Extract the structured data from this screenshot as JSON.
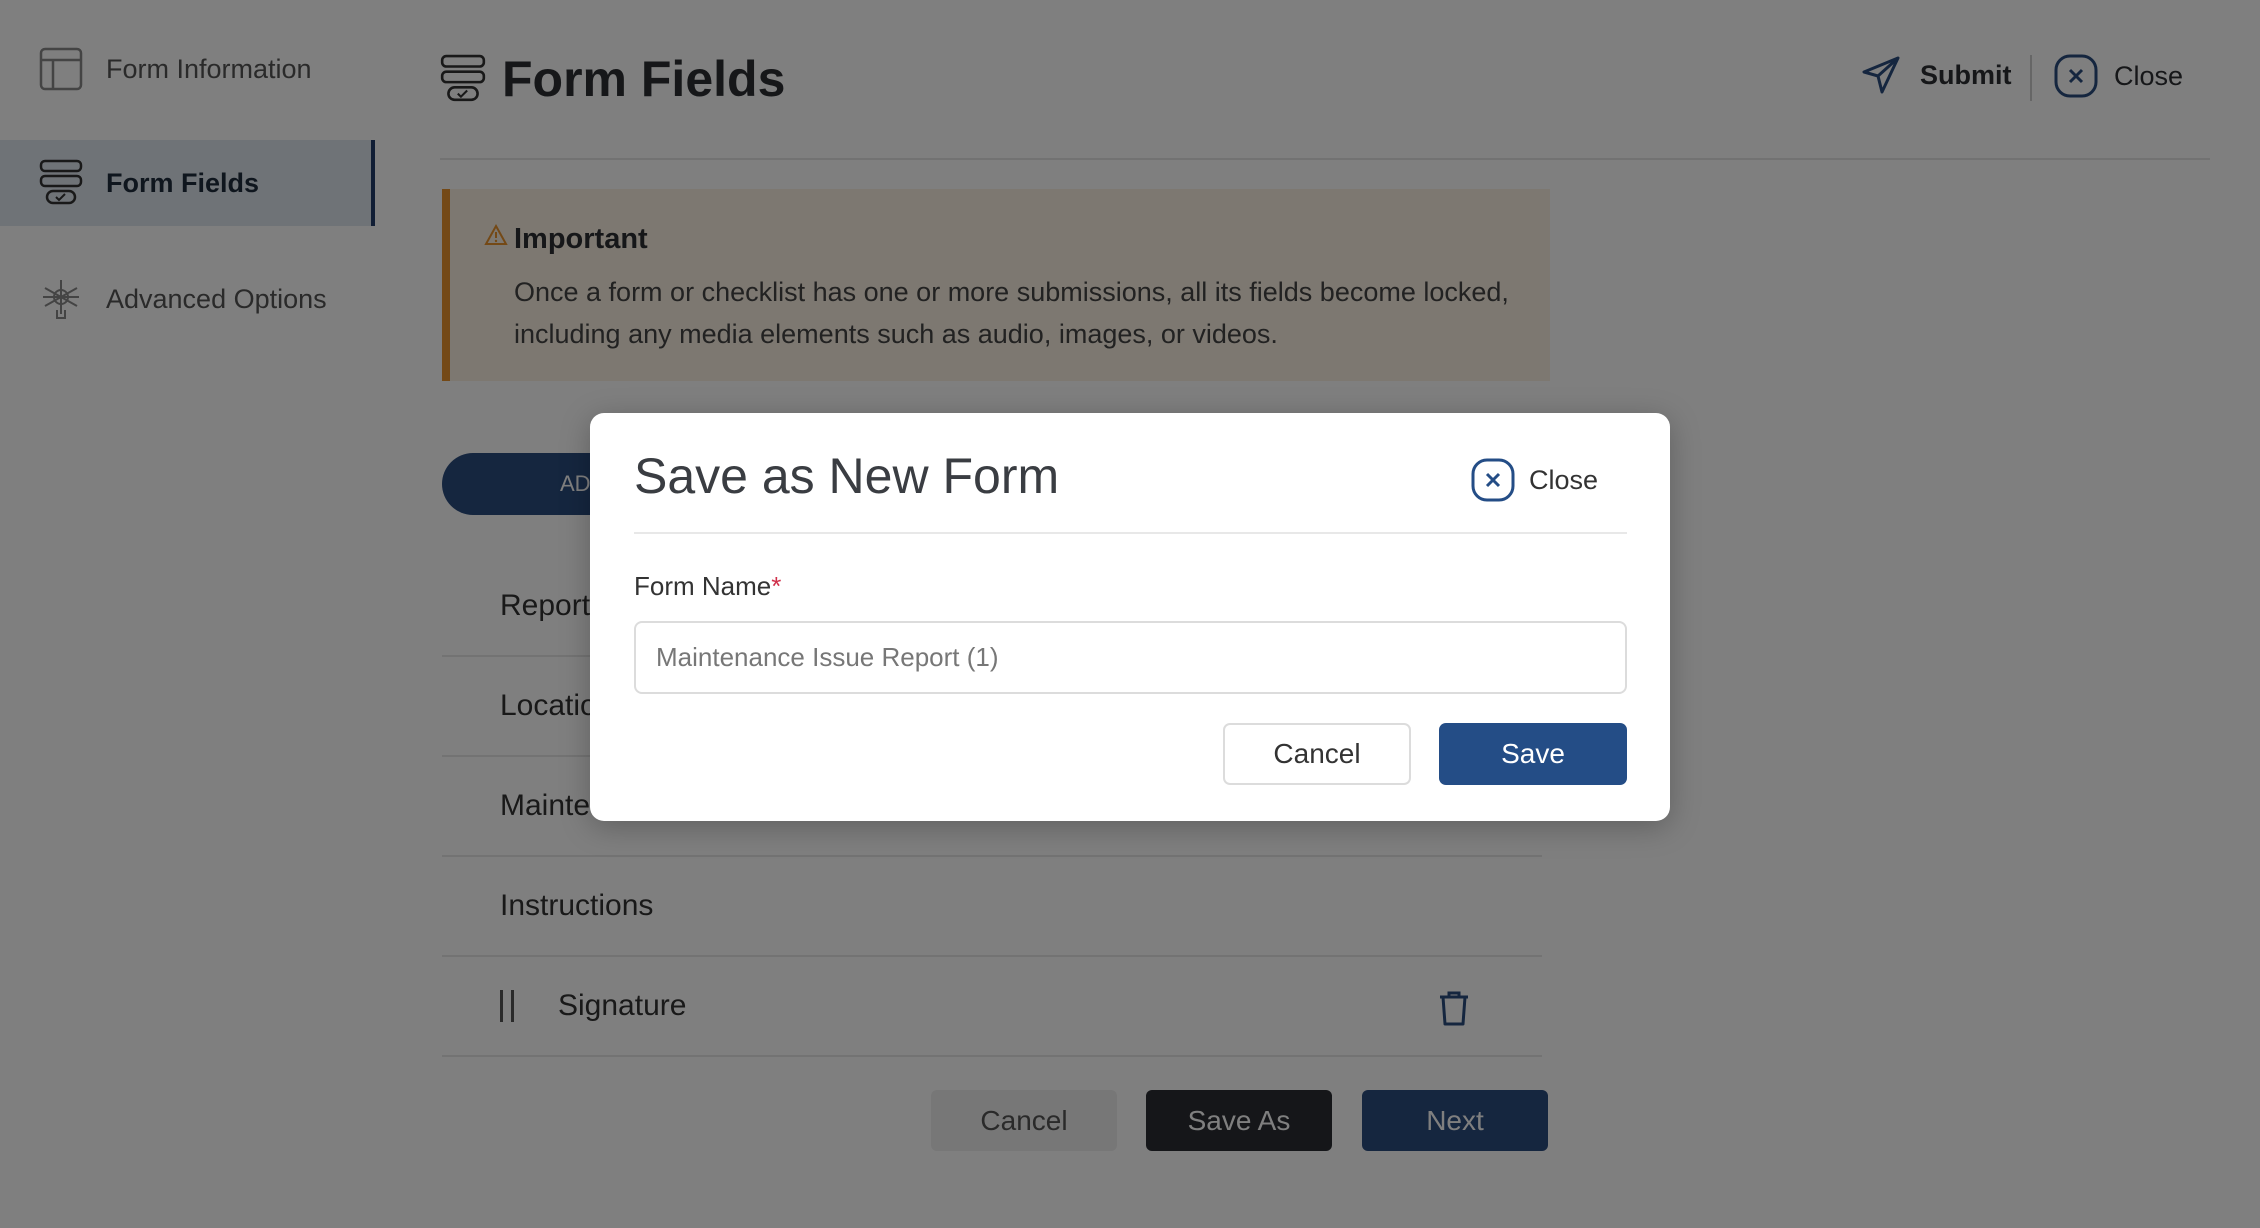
{
  "sidebar": {
    "items": [
      {
        "label": "Form Information",
        "icon": "layout-icon"
      },
      {
        "label": "Form Fields",
        "icon": "form-fields-icon",
        "active": true
      },
      {
        "label": "Advanced Options",
        "icon": "advanced-options-icon"
      }
    ]
  },
  "header": {
    "title": "Form Fields",
    "submit_label": "Submit",
    "close_label": "Close"
  },
  "banner": {
    "title": "Important",
    "text": "Once a form or checklist has one or more submissions, all its fields become locked, including any media elements such as audio, images, or videos."
  },
  "add_pill": {
    "label": "AD"
  },
  "fields": [
    {
      "label": "Report"
    },
    {
      "label": "Locatio"
    },
    {
      "label": "Mainte"
    },
    {
      "label": "Instructions"
    },
    {
      "label": "Signature"
    }
  ],
  "footer": {
    "cancel_label": "Cancel",
    "save_as_label": "Save As",
    "next_label": "Next"
  },
  "modal": {
    "title": "Save as New Form",
    "close_label": "Close",
    "field_label": "Form Name",
    "required_mark": "*",
    "input_value": "Maintenance Issue Report (1)",
    "cancel_label": "Cancel",
    "save_label": "Save"
  },
  "colors": {
    "primary": "#244d86",
    "dark": "#2a2d33",
    "warning": "#e8922c",
    "required": "#d0304a"
  }
}
